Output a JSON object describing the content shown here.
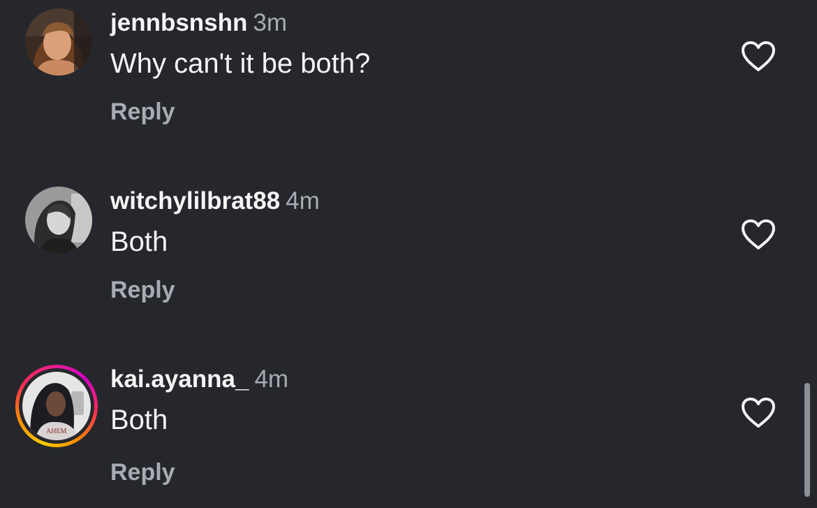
{
  "comments": [
    {
      "username": "jennbsnshn",
      "time": "3m",
      "text": "Why can't it be both?",
      "reply_label": "Reply",
      "like_icon": "heart-outline-icon",
      "has_story_ring": false
    },
    {
      "username": "witchylilbrat88",
      "time": "4m",
      "text": "Both",
      "reply_label": "Reply",
      "like_icon": "heart-outline-icon",
      "has_story_ring": false
    },
    {
      "username": "kai.ayanna_",
      "time": "4m",
      "text": "Both",
      "reply_label": "Reply",
      "like_icon": "heart-outline-icon",
      "has_story_ring": true
    }
  ],
  "colors": {
    "background": "#25272c",
    "primary_text": "#f5f5f5",
    "secondary_text": "#a8abb2",
    "scrollbar": "#8d9096"
  }
}
